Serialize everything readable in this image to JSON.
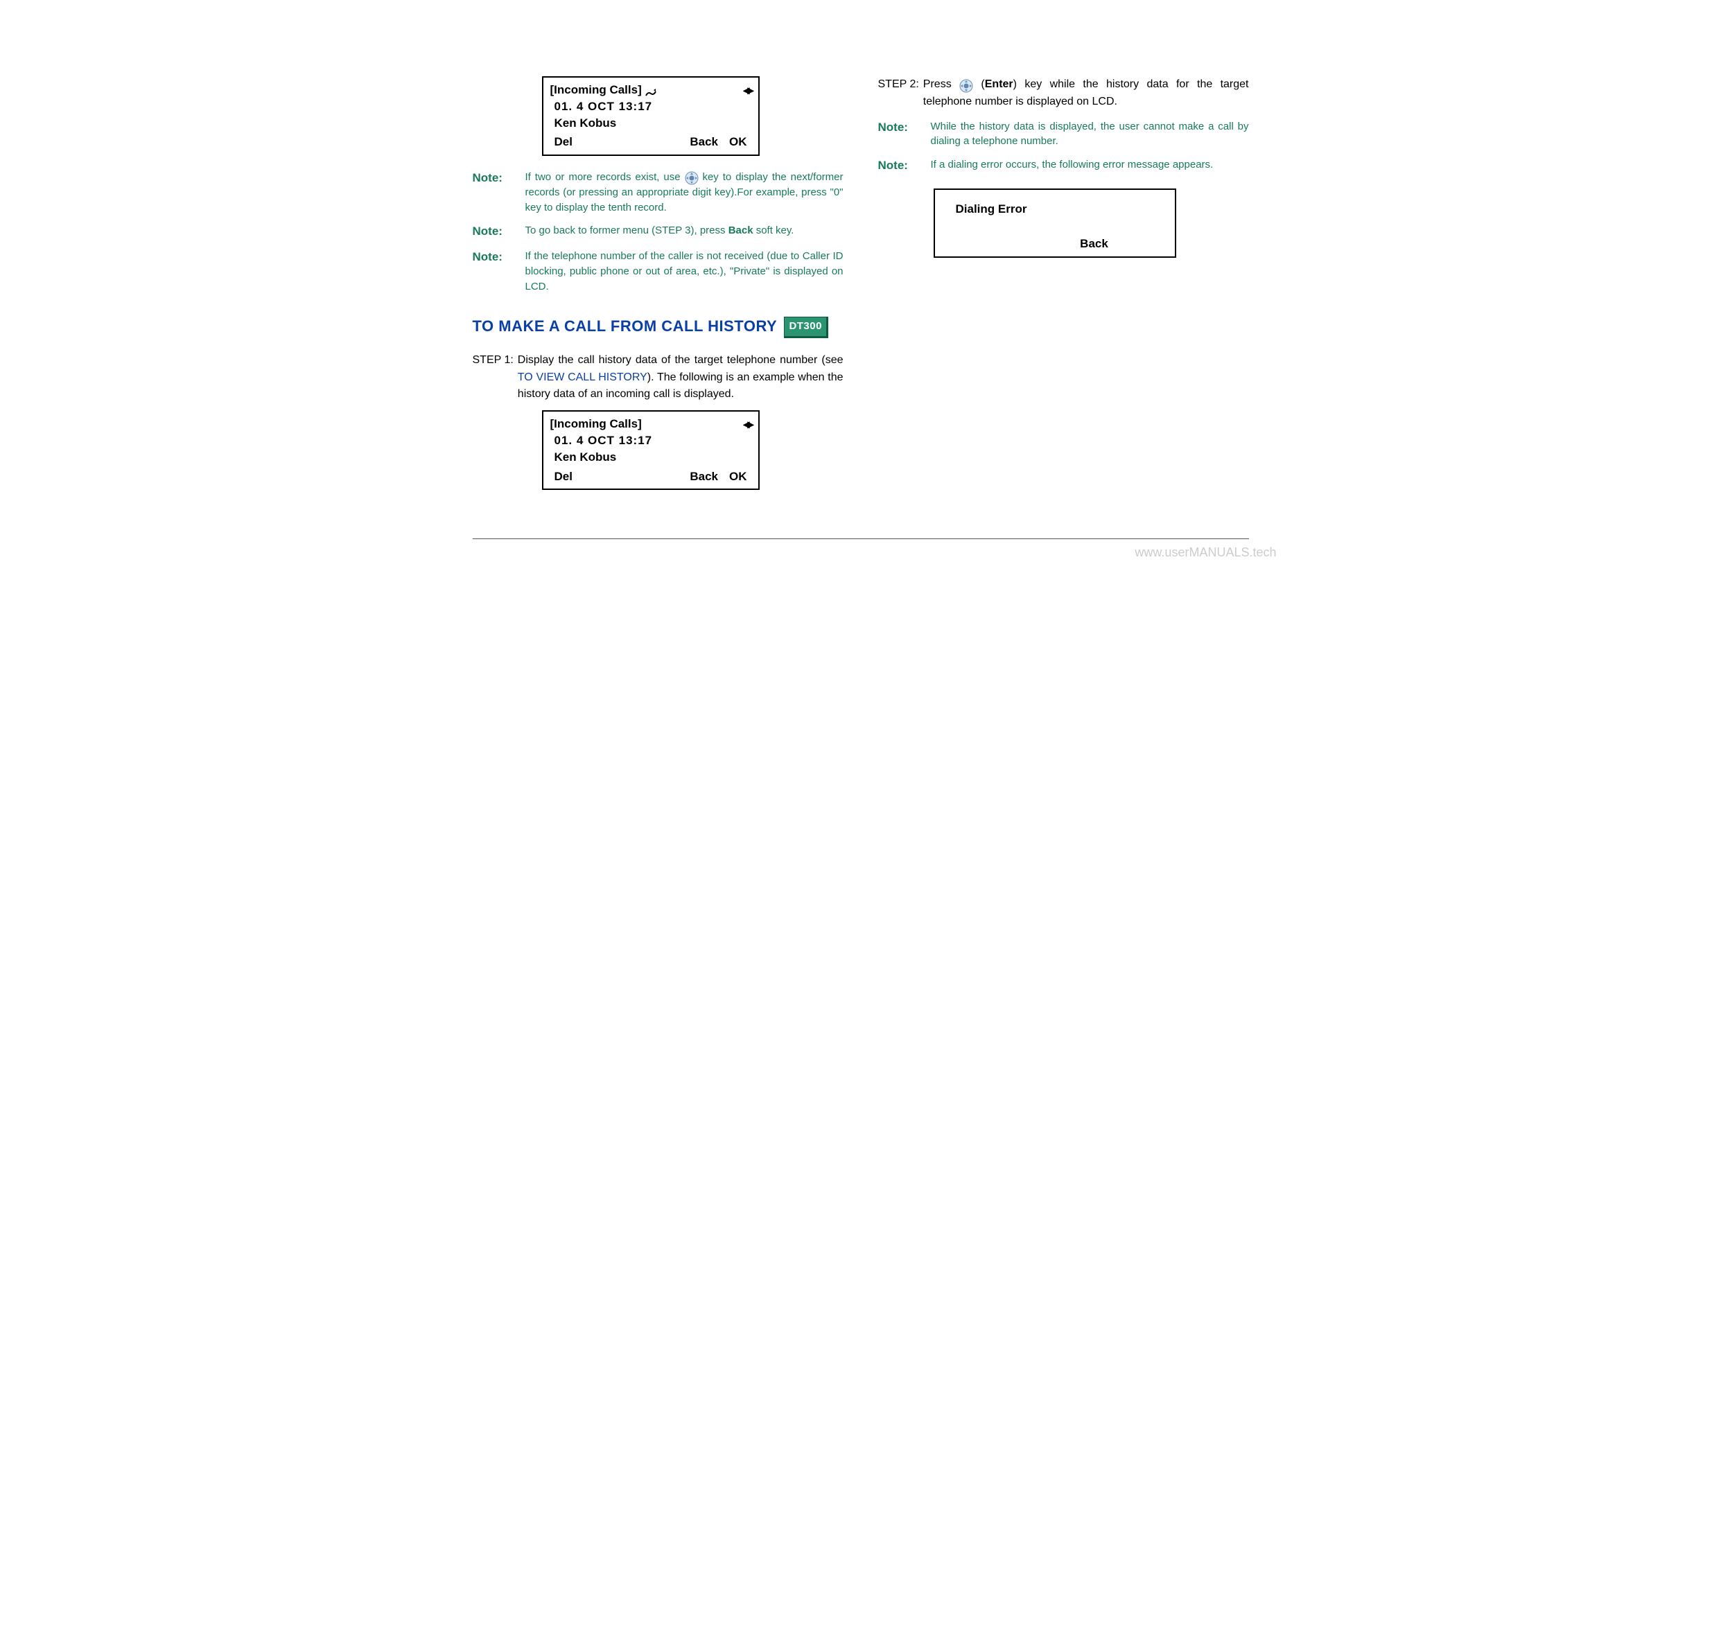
{
  "lcd1": {
    "title": "[Incoming Calls]",
    "line1": "01.   4    OCT    13:17",
    "line2": "Ken Kobus",
    "soft_left": "Del",
    "soft_mid": "Back",
    "soft_right": "OK"
  },
  "notes_left": [
    {
      "label": "Note:",
      "pre": "If two or more records exist, use ",
      "post": " key to display the next/former records (or pressing an appropriate digit key).For example, press \"0\" key to display the tenth record.",
      "has_icon": true
    },
    {
      "label": "Note:",
      "text": "To go back to former menu (STEP 3), press ",
      "bold": "Back",
      "tail": " soft key."
    },
    {
      "label": "Note:",
      "text": "If the telephone number of the caller is not received (due to Caller ID blocking, public phone or out of area, etc.),  \"Private\" is displayed on LCD."
    }
  ],
  "heading": {
    "text": "TO MAKE A CALL FROM CALL HISTORY",
    "tag": "DT300"
  },
  "step1": {
    "label": "STEP 1:",
    "pre": "Display the call history data of the target telephone number (see ",
    "link": "TO VIEW CALL HISTORY",
    "post": "). The following is an example when the history data of an incoming call is displayed."
  },
  "lcd2": {
    "title": "[Incoming Calls]",
    "line1": "01.   4    OCT    13:17",
    "line2": "Ken Kobus",
    "soft_left": "Del",
    "soft_mid": "Back",
    "soft_right": "OK"
  },
  "step2": {
    "label": "STEP 2:",
    "pre": "Press ",
    "mid": " (",
    "bold": "Enter",
    "post": ") key while the history data for the target telephone number is displayed on LCD."
  },
  "notes_right": [
    {
      "label": "Note:",
      "text": "While the history data is displayed, the user cannot make a call by dialing a telephone number."
    },
    {
      "label": "Note:",
      "text": "If a dialing error occurs, the following error message appears."
    }
  ],
  "error_lcd": {
    "title": "Dialing Error",
    "back": "Back"
  },
  "watermark": "www.userMANUALS.tech"
}
